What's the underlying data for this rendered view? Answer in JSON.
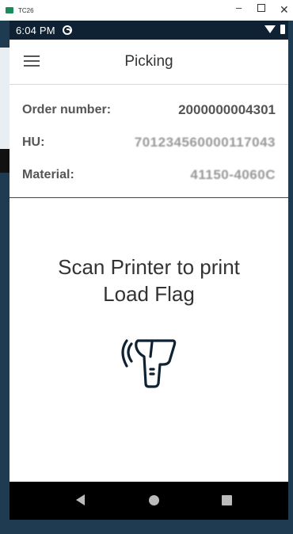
{
  "window": {
    "title": "TC26"
  },
  "statusbar": {
    "time": "6:04 PM"
  },
  "appbar": {
    "title": "Picking"
  },
  "fields": [
    {
      "label": "Order number:",
      "value": "2000000004301"
    },
    {
      "label": "HU:",
      "value": "701234560000117043"
    },
    {
      "label": "Material:",
      "value": "41150-4060C"
    }
  ],
  "message": {
    "line1": "Scan Printer to print",
    "line2": "Load Flag"
  },
  "icons": {
    "menu": "hamburger-icon",
    "scanner": "barcode-scanner-icon",
    "back": "back-icon",
    "home": "home-icon",
    "recents": "recents-icon"
  },
  "colors": {
    "statusbar": "#0e2233",
    "divider": "#2f4b63",
    "scanner": "#0e2233"
  }
}
